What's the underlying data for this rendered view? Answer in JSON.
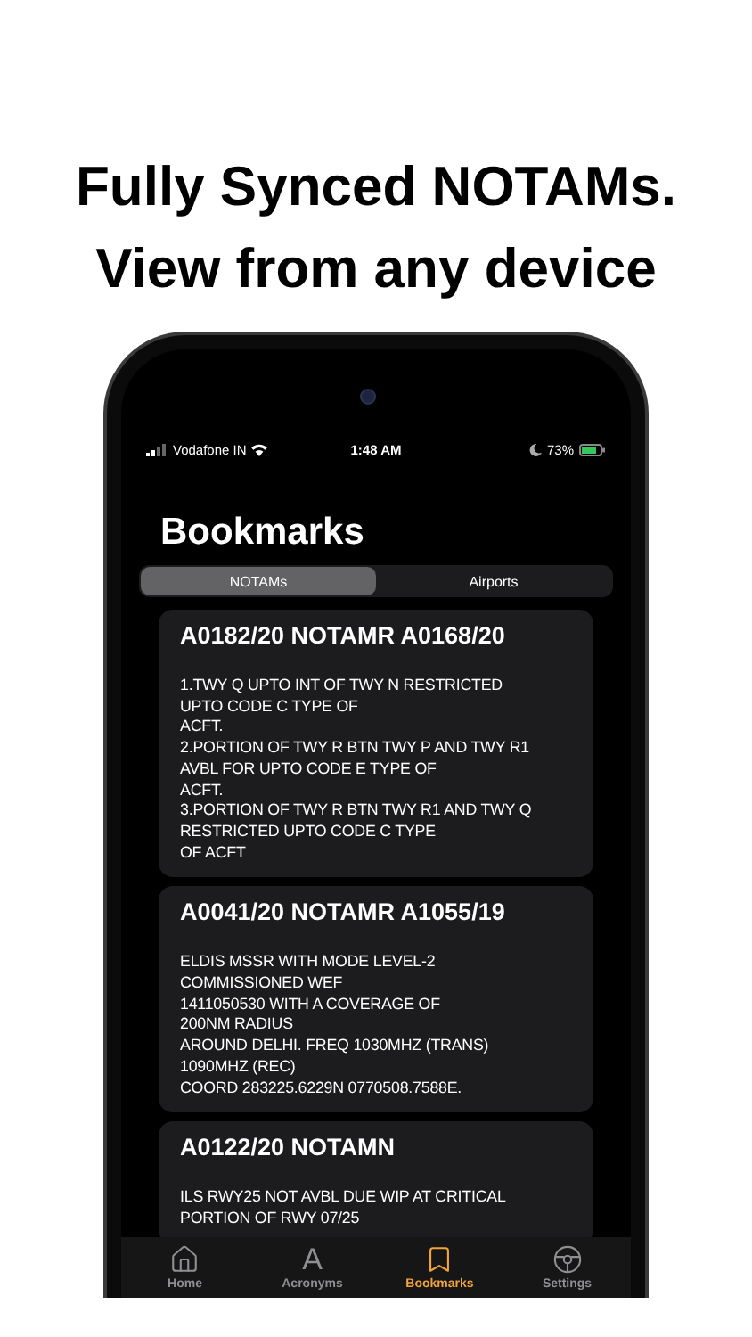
{
  "headline": [
    "Fully Synced NOTAMs.",
    "View from any device"
  ],
  "status_bar": {
    "carrier": "Vodafone IN",
    "time": "1:48 AM",
    "battery": "73%"
  },
  "title": "Bookmarks",
  "segments": [
    {
      "label": "NOTAMs",
      "selected": true
    },
    {
      "label": "Airports",
      "selected": false
    }
  ],
  "cards": [
    {
      "title": "A0182/20 NOTAMR A0168/20",
      "body": "1.TWY Q UPTO INT OF TWY N RESTRICTED\nUPTO CODE C TYPE OF\nACFT.\n2.PORTION OF TWY R BTN TWY P AND TWY R1\nAVBL FOR UPTO CODE E TYPE OF\nACFT.\n3.PORTION OF TWY R BTN TWY R1 AND TWY Q\nRESTRICTED UPTO CODE C TYPE\nOF ACFT"
    },
    {
      "title": "A0041/20 NOTAMR A1055/19",
      "body": "ELDIS MSSR WITH MODE LEVEL-2\nCOMMISSIONED WEF\n1411050530 WITH A COVERAGE OF\n200NM RADIUS\nAROUND DELHI. FREQ 1030MHZ (TRANS)\n1090MHZ (REC)\nCOORD 283225.6229N 0770508.7588E."
    },
    {
      "title": "A0122/20 NOTAMN",
      "body": "ILS RWY25 NOT AVBL DUE WIP AT CRITICAL\nPORTION OF RWY 07/25"
    }
  ],
  "tab_bar": [
    {
      "kind": "home",
      "label": "Home",
      "selected": false
    },
    {
      "kind": "letter",
      "glyph": "A",
      "label": "Acronyms",
      "selected": false
    },
    {
      "kind": "bookmark",
      "label": "Bookmarks",
      "selected": true
    },
    {
      "kind": "wheel",
      "label": "Settings",
      "selected": false
    }
  ]
}
